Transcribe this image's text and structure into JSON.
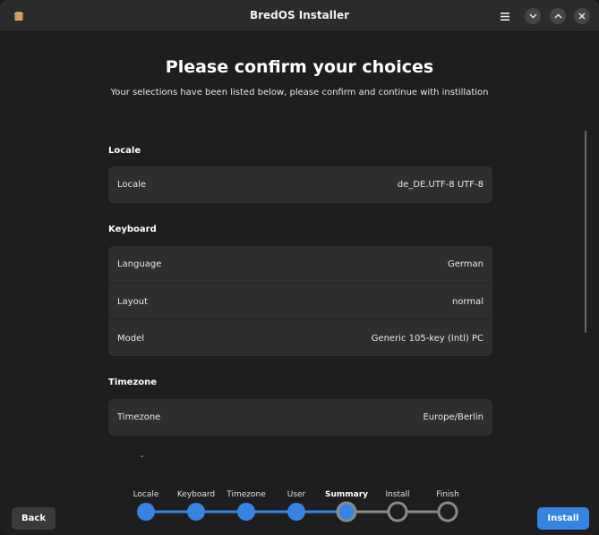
{
  "window": {
    "title": "BredOS Installer",
    "icons": [
      "app-icon",
      "menu-icon",
      "minimize-icon",
      "maximize-icon",
      "close-icon"
    ]
  },
  "page": {
    "heading": "Please confirm your choices",
    "subheading": "Your selections have been listed below, please confirm and continue with instillation"
  },
  "sections": [
    {
      "title": "Locale",
      "rows": [
        {
          "label": "Locale",
          "value": "de_DE.UTF-8 UTF-8"
        }
      ]
    },
    {
      "title": "Keyboard",
      "rows": [
        {
          "label": "Language",
          "value": "German"
        },
        {
          "label": "Layout",
          "value": "normal"
        },
        {
          "label": "Model",
          "value": "Generic 105-key (Intl) PC"
        }
      ]
    },
    {
      "title": "Timezone",
      "rows": [
        {
          "label": "Timezone",
          "value": "Europe/Berlin"
        }
      ]
    }
  ],
  "trailing_text": "-",
  "steps": [
    {
      "label": "Locale",
      "state": "done"
    },
    {
      "label": "Keyboard",
      "state": "done"
    },
    {
      "label": "Timezone",
      "state": "done"
    },
    {
      "label": "User",
      "state": "done"
    },
    {
      "label": "Summary",
      "state": "current"
    },
    {
      "label": "Install",
      "state": "pending"
    },
    {
      "label": "Finish",
      "state": "pending"
    }
  ],
  "buttons": {
    "back": "Back",
    "install": "Install"
  },
  "colors": {
    "accent": "#3584e4",
    "pending": "#8a8a8a",
    "card": "#2e2e2e",
    "background": "#1e1e1e"
  }
}
